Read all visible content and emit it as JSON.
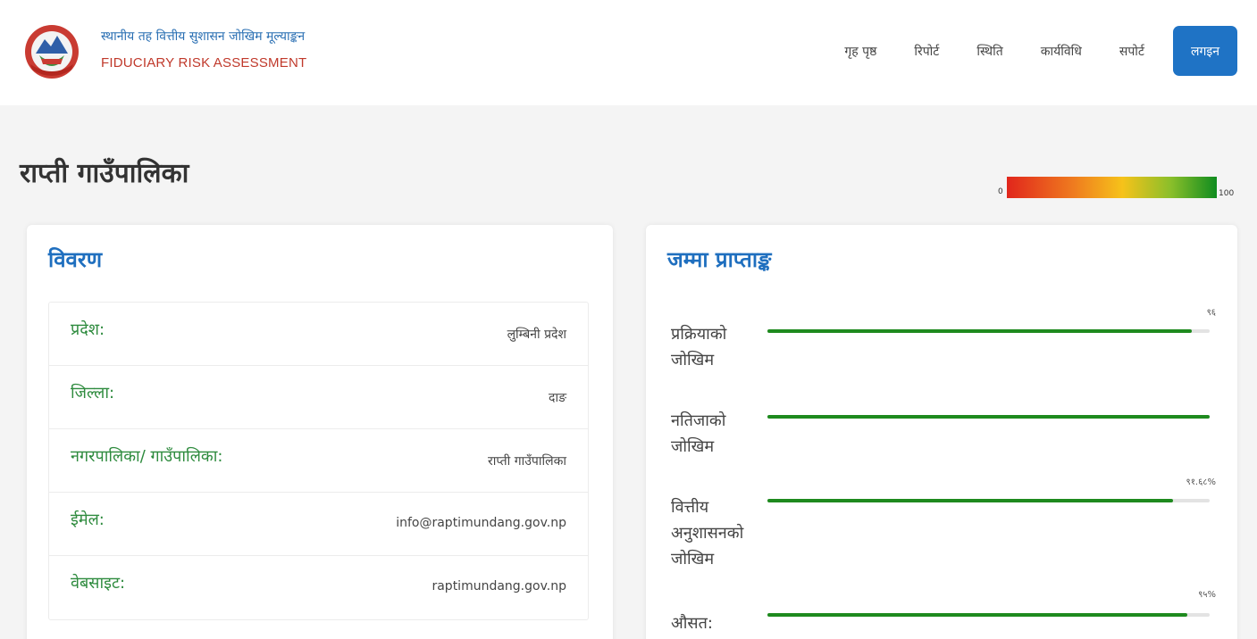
{
  "brand": {
    "name_np": "स्थानीय तह वित्तीय सुशासन जोखिम मूल्याङ्कन",
    "name_en": "FIDUCIARY RISK ASSESSMENT"
  },
  "nav": {
    "items": [
      "गृह पृष्ठ",
      "रिपोर्ट",
      "स्थिति",
      "कार्यविधि",
      "सपोर्ट"
    ],
    "login_label": "लगइन"
  },
  "page": {
    "title": "राप्ती गाउँपालिका"
  },
  "legend": {
    "min": "0",
    "max": "100",
    "colors": [
      "#e1261c",
      "#ef7c1f",
      "#f6c21a",
      "#8bbf2a",
      "#0f8c1f"
    ]
  },
  "details": {
    "heading": "विवरण",
    "rows": [
      {
        "label": "प्रदेश:",
        "value": "लुम्बिनी प्रदेश"
      },
      {
        "label": "जिल्ला:",
        "value": "दाङ"
      },
      {
        "label": "नगरपालिका/ गाउँपालिका:",
        "value": "राप्ती गाउँपालिका"
      },
      {
        "label": "ईमेल:",
        "value": "info@raptimundang.gov.np"
      },
      {
        "label": "वेबसाइट:",
        "value": "raptimundang.gov.np"
      }
    ]
  },
  "scores": {
    "heading": "जम्मा प्राप्ताङ्क",
    "items": [
      {
        "label": "प्रक्रियाको जोखिम",
        "value_text": "९६",
        "percent": 96
      },
      {
        "label": "नतिजाको जोखिम",
        "value_text": "",
        "percent": 100
      },
      {
        "label": "वित्तीय अनुशासनको जोखिम",
        "value_text": "९१.६८%",
        "percent": 91.68
      },
      {
        "label": "औसत:",
        "value_text": "९५%",
        "percent": 95
      }
    ],
    "bar_color": "#1e8a1e"
  }
}
